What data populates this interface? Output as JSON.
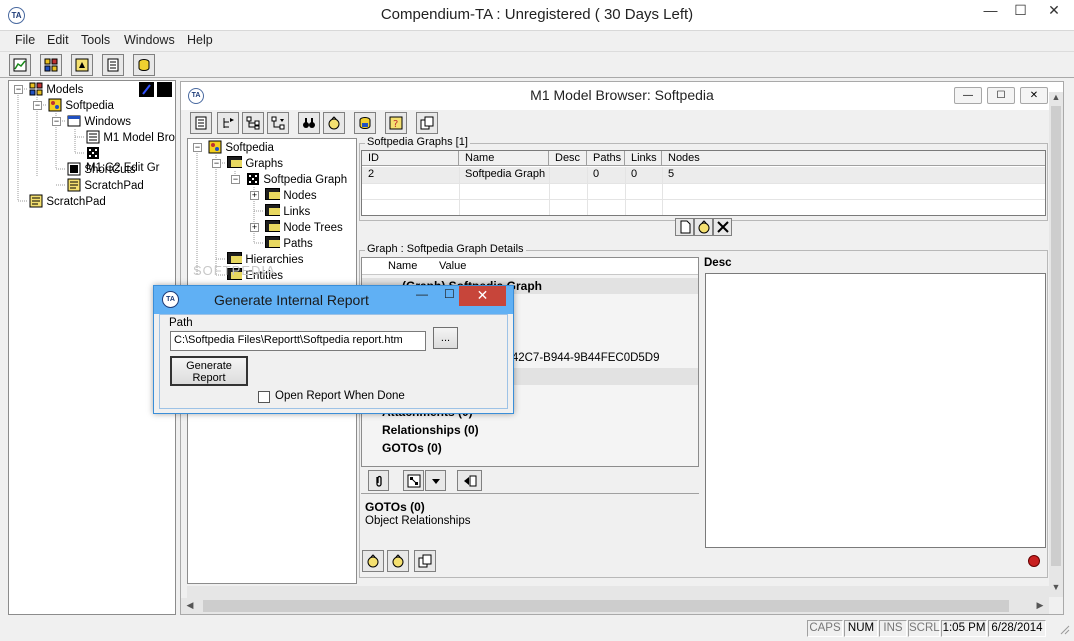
{
  "app": {
    "title": "Compendium-TA : Unregistered ( 30 Days Left)",
    "icon_text": "TA",
    "minimize": "—",
    "maximize": "☐",
    "close": "✕"
  },
  "menu": [
    "File",
    "Edit",
    "Tools",
    "Windows",
    "Help"
  ],
  "left_tree": {
    "items": [
      {
        "label": "Models"
      },
      {
        "label": "Softpedia"
      },
      {
        "label": "Windows"
      },
      {
        "label": "M1 Model Bro"
      },
      {
        "label": "M1:G2 Edit Gr"
      },
      {
        "label": "ShortCuts"
      },
      {
        "label": "ScratchPad"
      },
      {
        "label": "ScratchPad"
      }
    ]
  },
  "child_window": {
    "title": "M1 Model Browser: Softpedia",
    "tree": [
      {
        "label": "Softpedia"
      },
      {
        "label": "Graphs"
      },
      {
        "label": "Softpedia Graph"
      },
      {
        "label": "Nodes"
      },
      {
        "label": "Links"
      },
      {
        "label": "Node Trees"
      },
      {
        "label": "Paths"
      },
      {
        "label": "Hierarchies"
      },
      {
        "label": "Entities"
      }
    ],
    "graphs_group": "Softpedia Graphs [1]",
    "graphs_table": {
      "columns": [
        "ID",
        "Name",
        "Desc",
        "Paths",
        "Links",
        "Nodes"
      ],
      "rows": [
        [
          "2",
          "Softpedia Graph",
          "",
          "0",
          "0",
          "5"
        ]
      ]
    },
    "details_group": "Graph : Softpedia Graph Details",
    "details_columns": [
      "Name",
      "Value"
    ],
    "details_rows": [
      {
        "text": "(Graph) Softpedia Graph"
      },
      {
        "text": "-42C7-B944-9B44FEC0D5D9"
      },
      {
        "text": "Attachments (0)"
      },
      {
        "text": "Relationships (0)"
      },
      {
        "text": "GOTOs (0)"
      }
    ],
    "desc_header": "Desc",
    "info_title": "GOTOs (0)",
    "info_subtitle": "Object Relationships"
  },
  "dialog": {
    "title": "Generate Internal Report",
    "path_label": "Path",
    "path_value": "C:\\Softpedia Files\\Reportt\\Softpedia report.htm",
    "browse_label": "...",
    "generate_label_1": "Generate",
    "generate_label_2": "Report",
    "open_report_label": "Open Report When Done",
    "open_report_checked": false
  },
  "statusbar": {
    "caps": "CAPS",
    "num": "NUM",
    "ins": "INS",
    "scrl": "SCRL",
    "time": "1:05 PM",
    "date": "6/28/2014"
  },
  "watermark": "SOFTPEDIA"
}
